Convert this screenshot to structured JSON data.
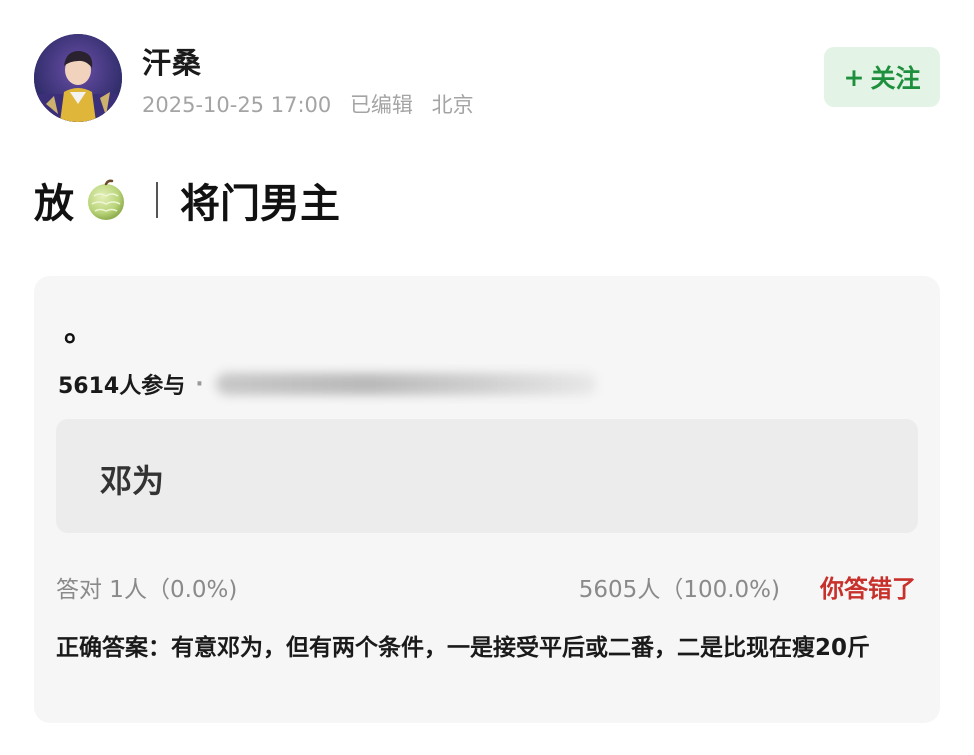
{
  "post": {
    "username": "汗桑",
    "timestamp": "2025-10-25 17:00",
    "edited": "已编辑",
    "location": "北京",
    "follow_label": "关注",
    "follow_plus": "+",
    "title_prefix": "放",
    "title_divider": "|",
    "title_suffix": "将门男主"
  },
  "quiz": {
    "question": "。",
    "participants": "5614人参与",
    "participants_dot": "·",
    "option": "邓为",
    "correct_stats": "答对  1人（0.0%)",
    "wrong_stats": "5605人（100.0%)",
    "result_badge": "你答错了",
    "answer_text": "正确答案：有意邓为，但有两个条件，一是接受平后或二番，二是比现在瘦20斤"
  },
  "icons": {
    "melon": "melon-icon",
    "avatar": "avatar"
  },
  "colors": {
    "follow_text": "#1e8f3c",
    "follow_bg": "#e3f4e6",
    "wrong": "#c8312b",
    "card_bg": "#f6f6f6",
    "option_bg": "#ececec"
  }
}
